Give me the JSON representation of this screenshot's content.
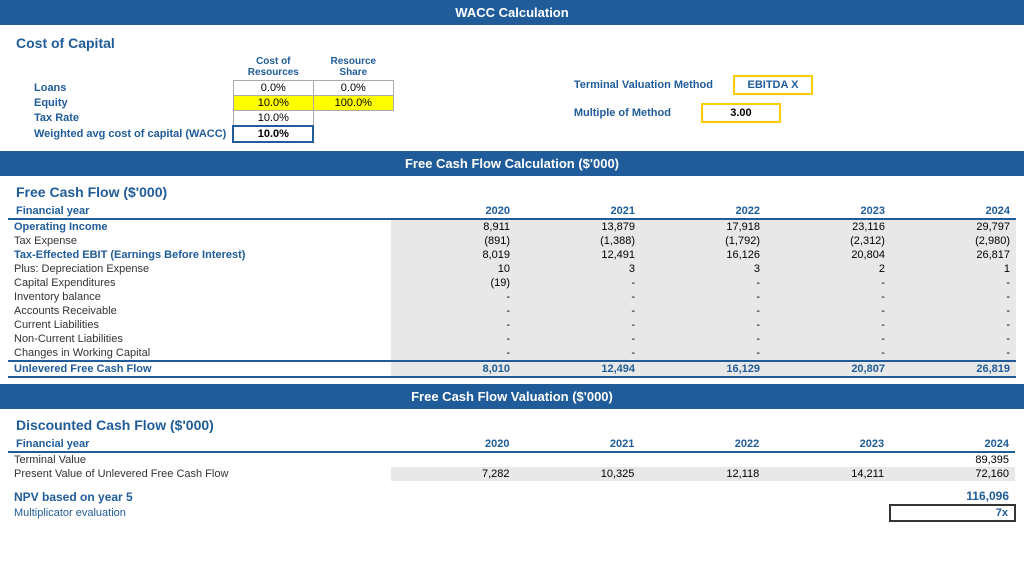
{
  "page": {
    "title": "WACC Calculation",
    "sections": {
      "wacc": {
        "header": "WACC Calculation",
        "title": "Cost of Capital",
        "col1_header": "Cost of Resources",
        "col2_header": "Resource Share",
        "rows": [
          {
            "label": "Loans",
            "col1": "0.0%",
            "col2": "0.0%",
            "col1_yellow": false,
            "col2_yellow": false
          },
          {
            "label": "Equity",
            "col1": "10.0%",
            "col2": "100.0%",
            "col1_yellow": true,
            "col2_yellow": true
          },
          {
            "label": "Tax Rate",
            "col1": "10.0%",
            "col2": "",
            "col1_yellow": false,
            "col2_yellow": false
          },
          {
            "label": "Weighted avg cost of capital (WACC)",
            "col1": "10.0%",
            "col2": "",
            "col1_bold": true,
            "col2_yellow": false
          }
        ],
        "terminal": {
          "label1": "Terminal Valuation Method",
          "label2": "Multiple of Method",
          "value1": "EBITDA X",
          "value2": "3.00"
        }
      },
      "fcf": {
        "header": "Free Cash Flow Calculation ($'000)",
        "title": "Free Cash Flow ($'000)",
        "col_header_label": "Financial year",
        "years": [
          "2020",
          "2021",
          "2022",
          "2023",
          "2024"
        ],
        "rows": [
          {
            "label": "Operating Income",
            "indent": "bold",
            "values": [
              "8,911",
              "13,879",
              "17,918",
              "23,116",
              "29,797"
            ],
            "bg": "gray"
          },
          {
            "label": "Tax Expense",
            "indent": "indent1",
            "values": [
              "(891)",
              "(1,388)",
              "(1,792)",
              "(2,312)",
              "(2,980)"
            ],
            "bg": "gray"
          },
          {
            "label": "Tax-Effected EBIT (Earnings Before Interest)",
            "indent": "bold",
            "values": [
              "8,019",
              "12,491",
              "16,126",
              "20,804",
              "26,817"
            ],
            "bg": "gray"
          },
          {
            "label": "Plus: Depreciation Expense",
            "indent": "indent1",
            "values": [
              "10",
              "3",
              "3",
              "2",
              "1"
            ],
            "bg": "gray"
          },
          {
            "label": "Capital Expenditures",
            "indent": "indent1",
            "values": [
              "(19)",
              "-",
              "-",
              "-",
              "-"
            ],
            "bg": "gray"
          },
          {
            "label": "Inventory balance",
            "indent": "indent3",
            "values": [
              "-",
              "-",
              "-",
              "-",
              "-"
            ],
            "bg": "gray"
          },
          {
            "label": "Accounts Receivable",
            "indent": "indent3",
            "values": [
              "-",
              "-",
              "-",
              "-",
              "-"
            ],
            "bg": "gray"
          },
          {
            "label": "Current Liabilities",
            "indent": "indent3",
            "values": [
              "-",
              "-",
              "-",
              "-",
              "-"
            ],
            "bg": "gray"
          },
          {
            "label": "Non-Current Liabilities",
            "indent": "indent3",
            "values": [
              "-",
              "-",
              "-",
              "-",
              "-"
            ],
            "bg": "gray"
          },
          {
            "label": "Changes in Working Capital",
            "indent": "indent1",
            "values": [
              "-",
              "-",
              "-",
              "-",
              "-"
            ],
            "bg": "gray"
          },
          {
            "label": "Unlevered Free Cash Flow",
            "indent": "bold_bottom",
            "values": [
              "8,010",
              "12,494",
              "16,129",
              "20,807",
              "26,819"
            ],
            "bg": "gray"
          }
        ]
      },
      "dcf": {
        "header": "Free Cash Flow Valuation ($'000)",
        "title": "Discounted Cash Flow ($'000)",
        "col_header_label": "Financial year",
        "years": [
          "2020",
          "2021",
          "2022",
          "2023",
          "2024"
        ],
        "rows": [
          {
            "label": "Terminal Value",
            "indent": "indent1",
            "values": [
              "",
              "",
              "",
              "",
              "89,395"
            ],
            "bg": "white"
          },
          {
            "label": "Present Value of Unlevered Free Cash Flow",
            "indent": "indent1",
            "values": [
              "7,282",
              "10,325",
              "12,118",
              "14,211",
              "72,160"
            ],
            "bg": "gray"
          }
        ],
        "npv": {
          "label": "NPV based on year 5",
          "value": "116,096"
        },
        "multiplicator": {
          "label": "Multiplicator evaluation",
          "value": "7x"
        }
      }
    }
  }
}
